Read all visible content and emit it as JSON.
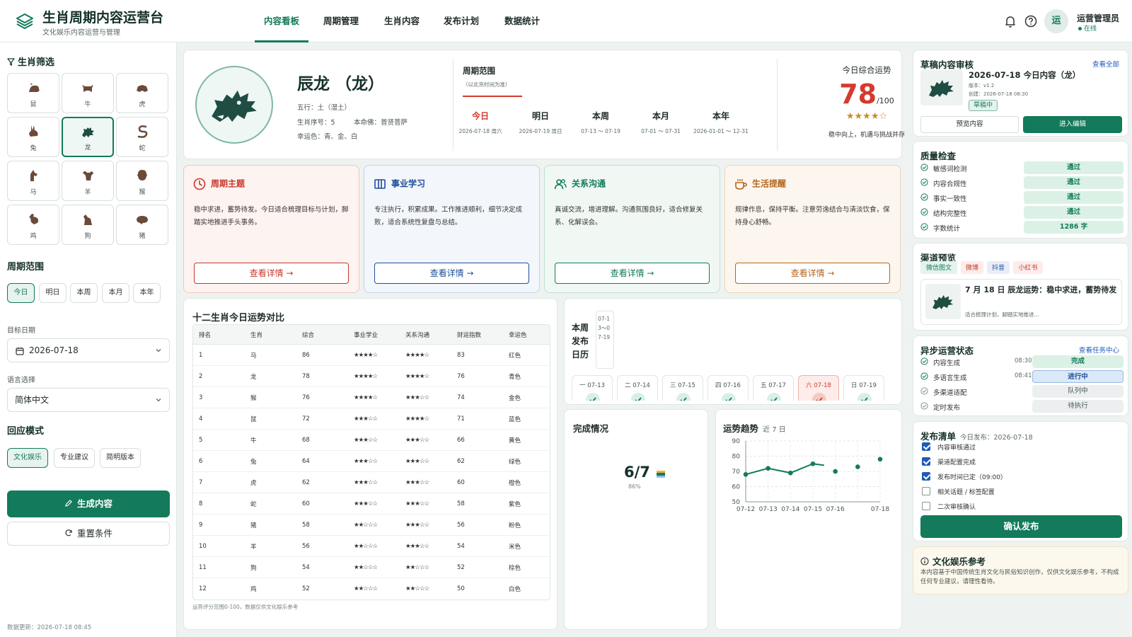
{
  "header": {
    "title": "生肖周期内容运营台",
    "subtitle": "文化娱乐内容运营与管理",
    "tabs": [
      "内容看板",
      "周期管理",
      "生肖内容",
      "发布计划",
      "数据统计"
    ],
    "active_tab": "内容看板",
    "avatar_text": "运",
    "user_name": "运营管理员",
    "user_status": "在线"
  },
  "sidebar": {
    "zodiac_title": "生肖筛选",
    "zodiacs": [
      "鼠",
      "牛",
      "虎",
      "兔",
      "龙",
      "蛇",
      "马",
      "羊",
      "猴",
      "鸡",
      "狗",
      "猪"
    ],
    "selected_zodiac": "龙",
    "period_title": "周期范围",
    "periods": [
      "今日",
      "明日",
      "本周",
      "本月",
      "本年"
    ],
    "selected_period": "今日",
    "date_label": "目标日期",
    "date_value": "2026-07-18",
    "lang_label": "语言选择",
    "lang_value": "简体中文",
    "mode_title": "回应模式",
    "modes": [
      "文化娱乐",
      "专业建议",
      "简明版本"
    ],
    "selected_mode": "文化娱乐",
    "generate_label": "生成内容",
    "reset_label": "重置条件",
    "data_update": "数据更新：2026-07-18 08:45"
  },
  "hero": {
    "name": "辰龙 （龙）",
    "element": "五行：土（湿土）",
    "order_label": "生肖序号：5",
    "buddha_label": "本命佛：普贤菩萨",
    "lucky_colors": "幸运色：青、金、白",
    "period_title": "周期范围",
    "period_note": "（以北京时间为准）",
    "periods": [
      {
        "name": "今日",
        "date": "2026-07-18 周六"
      },
      {
        "name": "明日",
        "date": "2026-07-19 周日"
      },
      {
        "name": "本周",
        "date": "07-13 ～ 07-19"
      },
      {
        "name": "本月",
        "date": "07-01 ～ 07-31"
      },
      {
        "name": "本年",
        "date": "2026-01-01 ～ 12-31"
      }
    ],
    "fortune_label": "今日综合运势",
    "fortune_score": "78",
    "fortune_max": "/100",
    "fortune_stars": "★★★★☆",
    "fortune_note": "稳中向上，机遇与挑战并存"
  },
  "themes": [
    {
      "title": "周期主题",
      "desc": "稳中求进，蓄势待发。今日适合梳理目标与计划，脚踏实地推进手头事务。",
      "button": "查看详情  →",
      "color": "#c8372d",
      "bg": "#fdf3f1",
      "border": "#f1c6bf",
      "icon": "clock-icon"
    },
    {
      "title": "事业学习",
      "desc": "专注执行，积累成果。工作推进顺利，细节决定成败，适合系统性复盘与总结。",
      "button": "查看详情  →",
      "color": "#1e4e9a",
      "bg": "#f3f6fb",
      "border": "#c4d2ea",
      "icon": "book-icon"
    },
    {
      "title": "关系沟通",
      "desc": "真诚交流，增进理解。沟通氛围良好，适合修复关系、化解误会。",
      "button": "查看详情  →",
      "color": "#137a5b",
      "bg": "#f1f8f4",
      "border": "#bfe0d1",
      "icon": "people-icon"
    },
    {
      "title": "生活提醒",
      "desc": "规律作息，保持平衡。注意劳逸结合与清淡饮食，保持身心舒畅。",
      "button": "查看详情  →",
      "color": "#b4661c",
      "bg": "#fdf6ee",
      "border": "#eed4b7",
      "icon": "cup-icon"
    }
  ],
  "table": {
    "title": "十二生肖今日运势对比",
    "headers": [
      "排名",
      "生肖",
      "综合",
      "事业学业",
      "关系沟通",
      "财运指数",
      "幸运色"
    ],
    "rows": [
      [
        "1",
        "马",
        "86",
        "★★★★☆",
        "★★★★☆",
        "83",
        "红色"
      ],
      [
        "2",
        "龙",
        "78",
        "★★★★☆",
        "★★★★☆",
        "76",
        "青色"
      ],
      [
        "3",
        "猴",
        "76",
        "★★★★☆",
        "★★★☆☆",
        "74",
        "金色"
      ],
      [
        "4",
        "鼠",
        "72",
        "★★★☆☆",
        "★★★★☆",
        "71",
        "蓝色"
      ],
      [
        "5",
        "牛",
        "68",
        "★★★☆☆",
        "★★★☆☆",
        "66",
        "黄色"
      ],
      [
        "6",
        "兔",
        "64",
        "★★★☆☆",
        "★★★☆☆",
        "62",
        "绿色"
      ],
      [
        "7",
        "虎",
        "62",
        "★★★☆☆",
        "★★★☆☆",
        "60",
        "橙色"
      ],
      [
        "8",
        "蛇",
        "60",
        "★★★☆☆",
        "★★★☆☆",
        "58",
        "紫色"
      ],
      [
        "9",
        "猪",
        "58",
        "★★☆☆☆",
        "★★★☆☆",
        "56",
        "粉色"
      ],
      [
        "10",
        "羊",
        "56",
        "★★☆☆☆",
        "★★★☆☆",
        "54",
        "米色"
      ],
      [
        "11",
        "狗",
        "54",
        "★★☆☆☆",
        "★★☆☆☆",
        "52",
        "棕色"
      ],
      [
        "12",
        "鸡",
        "52",
        "★★☆☆☆",
        "★★☆☆☆",
        "50",
        "白色"
      ]
    ],
    "note": "运势评分范围0-100，数据仅供文化娱乐参考"
  },
  "calendar": {
    "title": "本周发布日历",
    "range": "07-13～07-19",
    "days": [
      "一 07-13",
      "二 07-14",
      "三 07-15",
      "四 07-16",
      "五 07-17",
      "六 07-18",
      "日 07-19"
    ],
    "active_day": "六 07-18"
  },
  "completion": {
    "title": "完成情况",
    "value": "6/7",
    "percent": "86%"
  },
  "trend": {
    "title": "运势趋势",
    "subtitle": "近 7 日"
  },
  "chart_data": {
    "type": "line",
    "x": [
      "07-12",
      "07-13",
      "07-14",
      "07-15",
      "07-16",
      "07-17",
      "07-18"
    ],
    "x_tick_labels": [
      "07-12",
      "07-13",
      "07-14",
      "07-15",
      "07-16",
      "07-18"
    ],
    "values": [
      68,
      72,
      69,
      75,
      70,
      73,
      78
    ],
    "ylim": [
      50,
      90
    ],
    "yticks": [
      50,
      60,
      70,
      80,
      90
    ],
    "grid": true,
    "color": "#137a5b"
  },
  "draft": {
    "title": "草稿内容审核",
    "view_all": "查看全部",
    "item_title": "2026-07-18 今日内容（龙）",
    "version": "版本：v1.2",
    "created": "创建：2026-07-18 08:30",
    "status": "草稿中",
    "preview_label": "预览内容",
    "edit_label": "进入编辑"
  },
  "quality": {
    "title": "质量检查",
    "items": [
      {
        "label": "敏感词检测",
        "result": "通过"
      },
      {
        "label": "内容合规性",
        "result": "通过"
      },
      {
        "label": "事实一致性",
        "result": "通过"
      },
      {
        "label": "结构完整性",
        "result": "通过"
      },
      {
        "label": "字数统计",
        "result": "1286 字"
      }
    ]
  },
  "channel": {
    "title": "渠道预览",
    "chips": [
      {
        "label": "微信图文",
        "color": "#137a5b",
        "bg": "#e4f3ec"
      },
      {
        "label": "微博",
        "color": "#c8372d",
        "bg": "#fdecea"
      },
      {
        "label": "抖音",
        "color": "#1e4e9a",
        "bg": "#e8eef8"
      },
      {
        "label": "小红书",
        "color": "#c8372d",
        "bg": "#fdecea"
      }
    ],
    "post_title": "7 月 18 日 辰龙运势：稳中求进，蓄势待发",
    "post_desc": "适合梳理计划，脚踏实地推进..."
  },
  "async_status": {
    "title": "异步运营状态",
    "link": "查看任务中心",
    "items": [
      {
        "label": "内容生成",
        "time": "08:30",
        "status": "完成",
        "kind": "done"
      },
      {
        "label": "多语言生成",
        "time": "08:41",
        "status": "进行中",
        "kind": "progress"
      },
      {
        "label": "多渠道适配",
        "time": "",
        "status": "队列中",
        "kind": "queue"
      },
      {
        "label": "定时发布",
        "time": "",
        "status": "待执行",
        "kind": "queue"
      }
    ]
  },
  "publish": {
    "title": "发布清单",
    "subtitle": "今日发布：2026-07-18",
    "items": [
      {
        "label": "内容审核通过",
        "checked": true
      },
      {
        "label": "渠道配置完成",
        "checked": true
      },
      {
        "label": "发布时间已定（09:00）",
        "checked": true
      },
      {
        "label": "相关话题 / 标签配置",
        "checked": false
      },
      {
        "label": "二次审核确认",
        "checked": false
      }
    ],
    "button": "确认发布"
  },
  "reference": {
    "title": "文化娱乐参考",
    "text": "本内容基于中国传统生肖文化与民俗知识创作，仅供文化娱乐参考，不构成任何专业建议，请理性看待。"
  },
  "colors": {
    "primary": "#137a5b",
    "accent_red": "#d43a2e",
    "link_blue": "#1e5bb8"
  }
}
